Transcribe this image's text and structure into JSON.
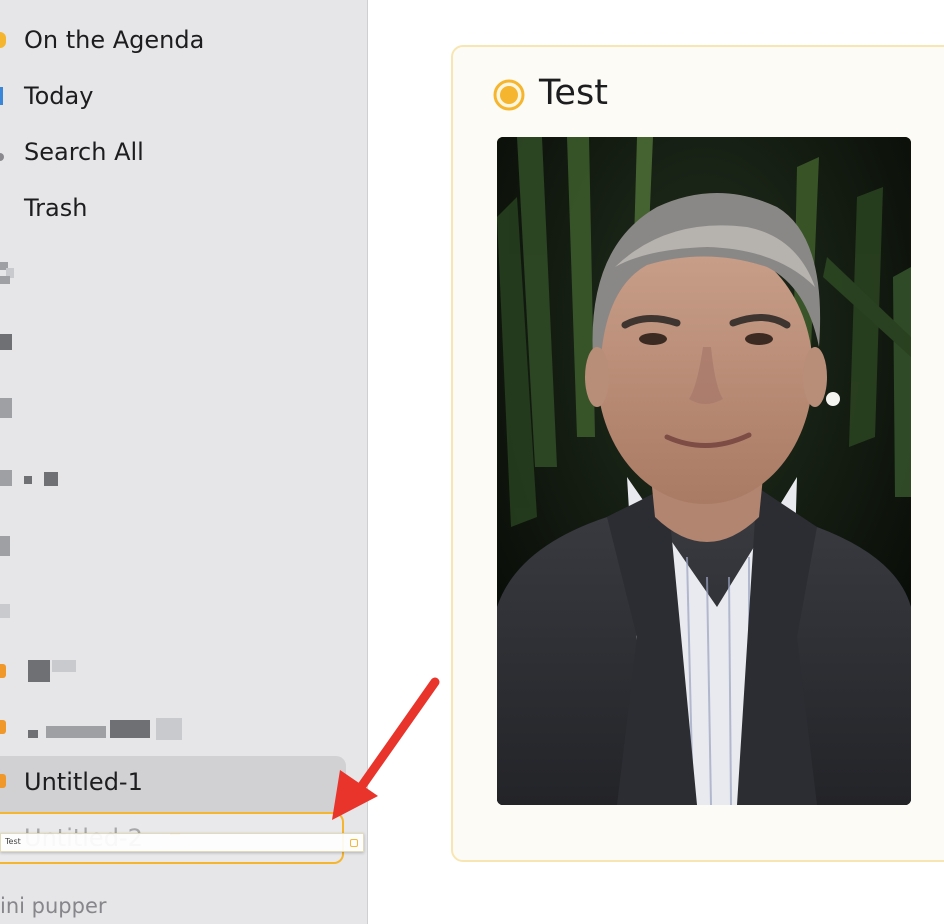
{
  "sidebar": {
    "nav": [
      {
        "label": "On the Agenda",
        "icon": "circle-dot-icon"
      },
      {
        "label": "Today",
        "icon": "calendar-icon"
      },
      {
        "label": "Search All",
        "icon": "search-icon"
      },
      {
        "label": "Trash",
        "icon": "trash-icon"
      }
    ],
    "selected_item": "Untitled-1",
    "drop_target_item": "Untitled-2",
    "footer": "ini pupper"
  },
  "drag_preview": {
    "label": "Test"
  },
  "card": {
    "title": "Test",
    "status_icon": "radio-selected-icon",
    "image_alt": "portrait-photo"
  },
  "colors": {
    "accent": "#f5b52e",
    "arrow": "#e8342a",
    "sidebar_bg": "#e6e6e8",
    "card_border": "#f8e6b2"
  }
}
